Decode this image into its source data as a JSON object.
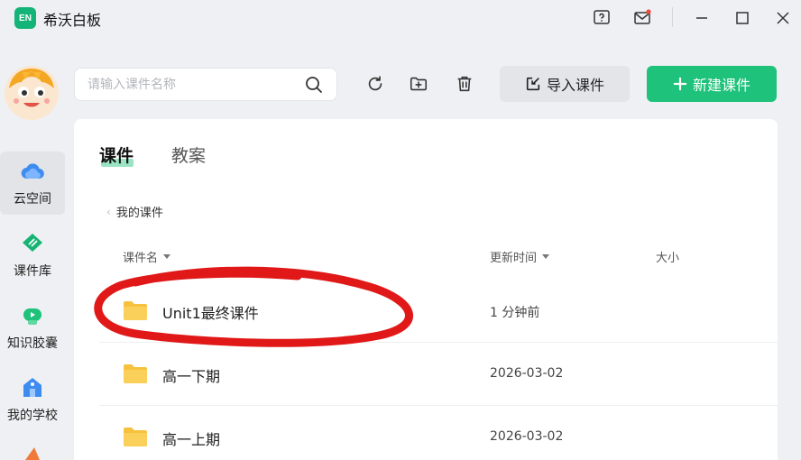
{
  "app": {
    "logo_text": "EN",
    "title": "希沃白板"
  },
  "sidebar": {
    "items": [
      {
        "label": "云空间",
        "icon": "cloud-icon",
        "active": true
      },
      {
        "label": "课件库",
        "icon": "courseware-library-icon",
        "active": false
      },
      {
        "label": "知识胶囊",
        "icon": "knowledge-capsule-icon",
        "active": false
      },
      {
        "label": "我的学校",
        "icon": "school-icon",
        "active": false
      }
    ]
  },
  "toolbar": {
    "search_placeholder": "请输入课件名称",
    "import_label": "导入课件",
    "new_label": "新建课件"
  },
  "tabs": [
    {
      "label": "课件",
      "active": true
    },
    {
      "label": "教案",
      "active": false
    }
  ],
  "breadcrumb": "我的课件",
  "table": {
    "columns": [
      "课件名",
      "更新时间",
      "大小"
    ],
    "rows": [
      {
        "name": "Unit1最终课件",
        "time": "1 分钟前"
      },
      {
        "name": "高一下期",
        "time": "2026-03-02"
      },
      {
        "name": "高一上期",
        "time": "2026-03-02"
      }
    ]
  },
  "colors": {
    "accent": "#1ec27a",
    "folder": "#f6c23e",
    "annotation": "#e01818"
  }
}
